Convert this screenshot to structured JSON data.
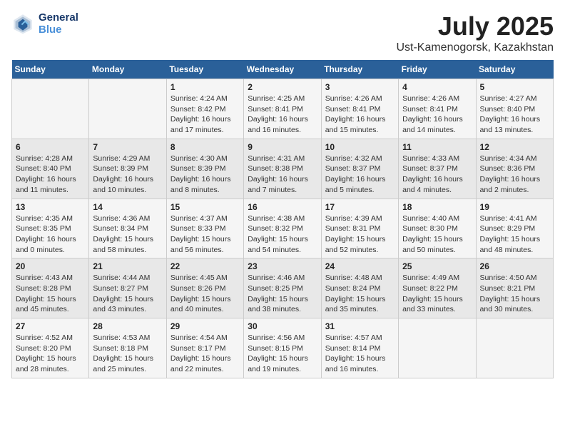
{
  "header": {
    "logo_line1": "General",
    "logo_line2": "Blue",
    "month_title": "July 2025",
    "location": "Ust-Kamenogorsk, Kazakhstan"
  },
  "weekdays": [
    "Sunday",
    "Monday",
    "Tuesday",
    "Wednesday",
    "Thursday",
    "Friday",
    "Saturday"
  ],
  "weeks": [
    [
      {
        "day": "",
        "info": ""
      },
      {
        "day": "",
        "info": ""
      },
      {
        "day": "1",
        "info": "Sunrise: 4:24 AM\nSunset: 8:42 PM\nDaylight: 16 hours\nand 17 minutes."
      },
      {
        "day": "2",
        "info": "Sunrise: 4:25 AM\nSunset: 8:41 PM\nDaylight: 16 hours\nand 16 minutes."
      },
      {
        "day": "3",
        "info": "Sunrise: 4:26 AM\nSunset: 8:41 PM\nDaylight: 16 hours\nand 15 minutes."
      },
      {
        "day": "4",
        "info": "Sunrise: 4:26 AM\nSunset: 8:41 PM\nDaylight: 16 hours\nand 14 minutes."
      },
      {
        "day": "5",
        "info": "Sunrise: 4:27 AM\nSunset: 8:40 PM\nDaylight: 16 hours\nand 13 minutes."
      }
    ],
    [
      {
        "day": "6",
        "info": "Sunrise: 4:28 AM\nSunset: 8:40 PM\nDaylight: 16 hours\nand 11 minutes."
      },
      {
        "day": "7",
        "info": "Sunrise: 4:29 AM\nSunset: 8:39 PM\nDaylight: 16 hours\nand 10 minutes."
      },
      {
        "day": "8",
        "info": "Sunrise: 4:30 AM\nSunset: 8:39 PM\nDaylight: 16 hours\nand 8 minutes."
      },
      {
        "day": "9",
        "info": "Sunrise: 4:31 AM\nSunset: 8:38 PM\nDaylight: 16 hours\nand 7 minutes."
      },
      {
        "day": "10",
        "info": "Sunrise: 4:32 AM\nSunset: 8:37 PM\nDaylight: 16 hours\nand 5 minutes."
      },
      {
        "day": "11",
        "info": "Sunrise: 4:33 AM\nSunset: 8:37 PM\nDaylight: 16 hours\nand 4 minutes."
      },
      {
        "day": "12",
        "info": "Sunrise: 4:34 AM\nSunset: 8:36 PM\nDaylight: 16 hours\nand 2 minutes."
      }
    ],
    [
      {
        "day": "13",
        "info": "Sunrise: 4:35 AM\nSunset: 8:35 PM\nDaylight: 16 hours\nand 0 minutes."
      },
      {
        "day": "14",
        "info": "Sunrise: 4:36 AM\nSunset: 8:34 PM\nDaylight: 15 hours\nand 58 minutes."
      },
      {
        "day": "15",
        "info": "Sunrise: 4:37 AM\nSunset: 8:33 PM\nDaylight: 15 hours\nand 56 minutes."
      },
      {
        "day": "16",
        "info": "Sunrise: 4:38 AM\nSunset: 8:32 PM\nDaylight: 15 hours\nand 54 minutes."
      },
      {
        "day": "17",
        "info": "Sunrise: 4:39 AM\nSunset: 8:31 PM\nDaylight: 15 hours\nand 52 minutes."
      },
      {
        "day": "18",
        "info": "Sunrise: 4:40 AM\nSunset: 8:30 PM\nDaylight: 15 hours\nand 50 minutes."
      },
      {
        "day": "19",
        "info": "Sunrise: 4:41 AM\nSunset: 8:29 PM\nDaylight: 15 hours\nand 48 minutes."
      }
    ],
    [
      {
        "day": "20",
        "info": "Sunrise: 4:43 AM\nSunset: 8:28 PM\nDaylight: 15 hours\nand 45 minutes."
      },
      {
        "day": "21",
        "info": "Sunrise: 4:44 AM\nSunset: 8:27 PM\nDaylight: 15 hours\nand 43 minutes."
      },
      {
        "day": "22",
        "info": "Sunrise: 4:45 AM\nSunset: 8:26 PM\nDaylight: 15 hours\nand 40 minutes."
      },
      {
        "day": "23",
        "info": "Sunrise: 4:46 AM\nSunset: 8:25 PM\nDaylight: 15 hours\nand 38 minutes."
      },
      {
        "day": "24",
        "info": "Sunrise: 4:48 AM\nSunset: 8:24 PM\nDaylight: 15 hours\nand 35 minutes."
      },
      {
        "day": "25",
        "info": "Sunrise: 4:49 AM\nSunset: 8:22 PM\nDaylight: 15 hours\nand 33 minutes."
      },
      {
        "day": "26",
        "info": "Sunrise: 4:50 AM\nSunset: 8:21 PM\nDaylight: 15 hours\nand 30 minutes."
      }
    ],
    [
      {
        "day": "27",
        "info": "Sunrise: 4:52 AM\nSunset: 8:20 PM\nDaylight: 15 hours\nand 28 minutes."
      },
      {
        "day": "28",
        "info": "Sunrise: 4:53 AM\nSunset: 8:18 PM\nDaylight: 15 hours\nand 25 minutes."
      },
      {
        "day": "29",
        "info": "Sunrise: 4:54 AM\nSunset: 8:17 PM\nDaylight: 15 hours\nand 22 minutes."
      },
      {
        "day": "30",
        "info": "Sunrise: 4:56 AM\nSunset: 8:15 PM\nDaylight: 15 hours\nand 19 minutes."
      },
      {
        "day": "31",
        "info": "Sunrise: 4:57 AM\nSunset: 8:14 PM\nDaylight: 15 hours\nand 16 minutes."
      },
      {
        "day": "",
        "info": ""
      },
      {
        "day": "",
        "info": ""
      }
    ]
  ]
}
